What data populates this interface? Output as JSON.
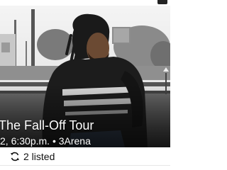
{
  "event": {
    "title": "The Fall-Off Tour",
    "date_time": "2, 6:30p.m.",
    "separator": "•",
    "venue": "3Arena",
    "listing_count": "2 listed"
  },
  "icons": {
    "listing": "swap-arrows-icon"
  },
  "colors": {
    "overlay_text": "#ffffff",
    "body_text": "#111111",
    "background": "#ffffff"
  }
}
